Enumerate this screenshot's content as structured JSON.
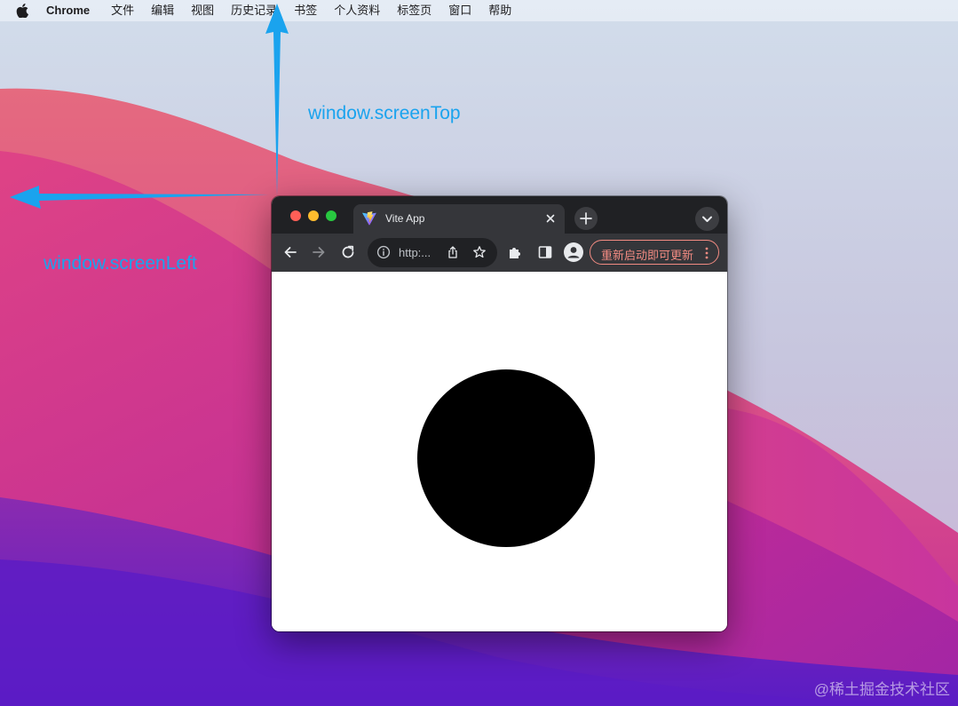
{
  "menubar": {
    "app_name": "Chrome",
    "items": [
      "文件",
      "编辑",
      "视图",
      "历史记录",
      "书签",
      "个人资料",
      "标签页",
      "窗口",
      "帮助"
    ]
  },
  "annotations": {
    "screen_top_label": "window.screenTop",
    "screen_left_label": "window.screenLeft",
    "arrow_color": "#1aa3ee"
  },
  "browser": {
    "tab_title": "Vite App",
    "url_text": "http:...",
    "update_button_label": "重新启动即可更新",
    "content_background": "#ffffff",
    "shape_color": "#000000"
  },
  "watermark": "@稀土掘金技术社区",
  "icons": [
    "apple-logo",
    "vite-favicon",
    "close-icon",
    "plus-icon",
    "chevron-down-icon",
    "back-arrow-icon",
    "forward-arrow-icon",
    "reload-icon",
    "info-icon",
    "share-icon",
    "star-icon",
    "puzzle-icon",
    "side-panel-icon",
    "profile-avatar-icon",
    "more-vert-icon"
  ]
}
